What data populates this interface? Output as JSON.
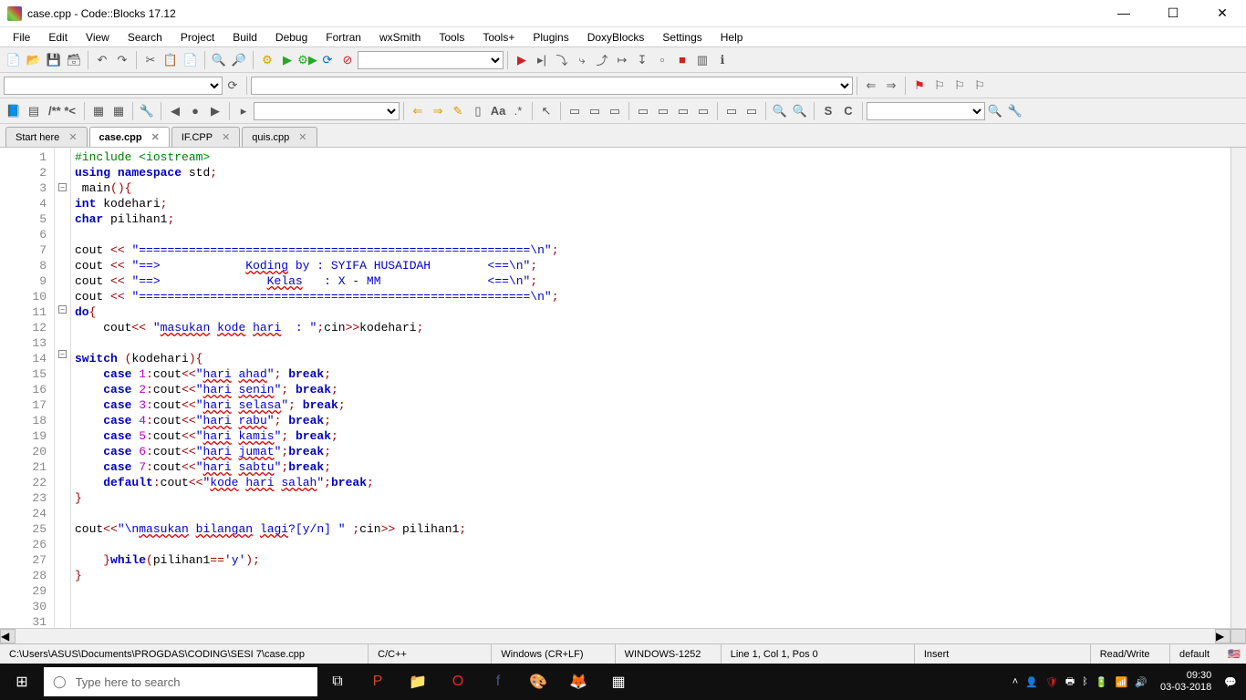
{
  "window": {
    "title": "case.cpp - Code::Blocks 17.12",
    "min": "—",
    "max": "☐",
    "close": "✕"
  },
  "menubar": [
    "File",
    "Edit",
    "View",
    "Search",
    "Project",
    "Build",
    "Debug",
    "Fortran",
    "wxSmith",
    "Tools",
    "Tools+",
    "Plugins",
    "DoxyBlocks",
    "Settings",
    "Help"
  ],
  "tabs": [
    {
      "label": "Start here",
      "active": false
    },
    {
      "label": "case.cpp",
      "active": true
    },
    {
      "label": "IF.CPP",
      "active": false
    },
    {
      "label": "quis.cpp",
      "active": false
    }
  ],
  "code_lines": [
    {
      "n": 1,
      "fold": "",
      "html": "<span class='pp'>#include &lt;iostream&gt;</span>"
    },
    {
      "n": 2,
      "fold": "",
      "html": "<span class='kw'>using</span> <span class='kw'>namespace</span> std<span class='op'>;</span>"
    },
    {
      "n": 3,
      "fold": "-",
      "html": " main<span class='op'>(){</span>"
    },
    {
      "n": 4,
      "fold": "",
      "html": "<span class='kw'>int</span> kodehari<span class='op'>;</span>"
    },
    {
      "n": 5,
      "fold": "",
      "html": "<span class='kw'>char</span> pilihan1<span class='op'>;</span>"
    },
    {
      "n": 6,
      "fold": "",
      "html": ""
    },
    {
      "n": 7,
      "fold": "",
      "html": "cout <span class='op'>&lt;&lt;</span> <span class='str'>\"=======================================================\\n\"</span><span class='op'>;</span>"
    },
    {
      "n": 8,
      "fold": "",
      "html": "cout <span class='op'>&lt;&lt;</span> <span class='str'>\"==&gt;            <span class='underline'>Koding</span> by : SYIFA HUSAIDAH        &lt;==\\n\"</span><span class='op'>;</span>"
    },
    {
      "n": 9,
      "fold": "",
      "html": "cout <span class='op'>&lt;&lt;</span> <span class='str'>\"==&gt;               <span class='underline'>Kelas</span>   : X - MM               &lt;==\\n\"</span><span class='op'>;</span>"
    },
    {
      "n": 10,
      "fold": "",
      "html": "cout <span class='op'>&lt;&lt;</span> <span class='str'>\"=======================================================\\n\"</span><span class='op'>;</span>"
    },
    {
      "n": 11,
      "fold": "-",
      "html": "<span class='kw'>do</span><span class='op'>{</span>"
    },
    {
      "n": 12,
      "fold": "",
      "html": "    cout<span class='op'>&lt;&lt;</span> <span class='str'>\"<span class='underline'>masukan</span> <span class='underline'>kode</span> <span class='underline'>hari</span>  : \"</span><span class='op'>;</span>cin<span class='op'>&gt;&gt;</span>kodehari<span class='op'>;</span>"
    },
    {
      "n": 13,
      "fold": "",
      "html": ""
    },
    {
      "n": 14,
      "fold": "-",
      "html": "<span class='kw'>switch</span> <span class='op'>(</span>kodehari<span class='op'>){</span>"
    },
    {
      "n": 15,
      "fold": "",
      "html": "    <span class='kw'>case</span> <span class='num'>1</span><span class='op'>:</span>cout<span class='op'>&lt;&lt;</span><span class='str'>\"<span class='underline'>hari</span> <span class='underline'>ahad</span>\"</span><span class='op'>;</span> <span class='kw'>break</span><span class='op'>;</span>"
    },
    {
      "n": 16,
      "fold": "",
      "html": "    <span class='kw'>case</span> <span class='num'>2</span><span class='op'>:</span>cout<span class='op'>&lt;&lt;</span><span class='str'>\"<span class='underline'>hari</span> <span class='underline'>senin</span>\"</span><span class='op'>;</span> <span class='kw'>break</span><span class='op'>;</span>"
    },
    {
      "n": 17,
      "fold": "",
      "html": "    <span class='kw'>case</span> <span class='num'>3</span><span class='op'>:</span>cout<span class='op'>&lt;&lt;</span><span class='str'>\"<span class='underline'>hari</span> <span class='underline'>selasa</span>\"</span><span class='op'>;</span> <span class='kw'>break</span><span class='op'>;</span>"
    },
    {
      "n": 18,
      "fold": "",
      "html": "    <span class='kw'>case</span> <span class='num'>4</span><span class='op'>:</span>cout<span class='op'>&lt;&lt;</span><span class='str'>\"<span class='underline'>hari</span> <span class='underline'>rabu</span>\"</span><span class='op'>;</span> <span class='kw'>break</span><span class='op'>;</span>"
    },
    {
      "n": 19,
      "fold": "",
      "html": "    <span class='kw'>case</span> <span class='num'>5</span><span class='op'>:</span>cout<span class='op'>&lt;&lt;</span><span class='str'>\"<span class='underline'>hari</span> <span class='underline'>kamis</span>\"</span><span class='op'>;</span> <span class='kw'>break</span><span class='op'>;</span>"
    },
    {
      "n": 20,
      "fold": "",
      "html": "    <span class='kw'>case</span> <span class='num'>6</span><span class='op'>:</span>cout<span class='op'>&lt;&lt;</span><span class='str'>\"<span class='underline'>hari</span> <span class='underline'>jumat</span>\"</span><span class='op'>;</span><span class='kw'>break</span><span class='op'>;</span>"
    },
    {
      "n": 21,
      "fold": "",
      "html": "    <span class='kw'>case</span> <span class='num'>7</span><span class='op'>:</span>cout<span class='op'>&lt;&lt;</span><span class='str'>\"<span class='underline'>hari</span> <span class='underline'>sabtu</span>\"</span><span class='op'>;</span><span class='kw'>break</span><span class='op'>;</span>"
    },
    {
      "n": 22,
      "fold": "",
      "html": "    <span class='kw'>default</span><span class='op'>:</span>cout<span class='op'>&lt;&lt;</span><span class='str'>\"<span class='underline'>kode</span> <span class='underline'>hari</span> <span class='underline'>salah</span>\"</span><span class='op'>;</span><span class='kw'>break</span><span class='op'>;</span>"
    },
    {
      "n": 23,
      "fold": "",
      "html": "<span class='op'>}</span>"
    },
    {
      "n": 24,
      "fold": "",
      "html": ""
    },
    {
      "n": 25,
      "fold": "",
      "html": "cout<span class='op'>&lt;&lt;</span><span class='str'>\"\\n<span class='underline'>masukan</span> <span class='underline'>bilangan</span> <span class='underline'>lagi</span>?[y/n] \"</span> <span class='op'>;</span>cin<span class='op'>&gt;&gt;</span> pilihan1<span class='op'>;</span>"
    },
    {
      "n": 26,
      "fold": "",
      "html": ""
    },
    {
      "n": 27,
      "fold": "",
      "html": "    <span class='op'>}</span><span class='kw'>while</span><span class='op'>(</span>pilihan1<span class='op'>==</span><span class='str'>'y'</span><span class='op'>);</span>"
    },
    {
      "n": 28,
      "fold": "",
      "html": "<span class='op'>}</span>"
    },
    {
      "n": 29,
      "fold": "",
      "html": ""
    },
    {
      "n": 30,
      "fold": "",
      "html": ""
    },
    {
      "n": 31,
      "fold": "",
      "html": ""
    }
  ],
  "status": {
    "path": "C:\\Users\\ASUS\\Documents\\PROGDAS\\CODING\\SESI 7\\case.cpp",
    "lang": "C/C++",
    "eol": "Windows (CR+LF)",
    "enc": "WINDOWS-1252",
    "pos": "Line 1, Col 1, Pos 0",
    "ins": "Insert",
    "rw": "Read/Write",
    "profile": "default"
  },
  "toolbar3_text": "/** *<",
  "toolbar3_s": "S",
  "toolbar3_c": "C",
  "taskbar": {
    "search_placeholder": "Type here to search",
    "time": "09:30",
    "date": "03-03-2018"
  }
}
